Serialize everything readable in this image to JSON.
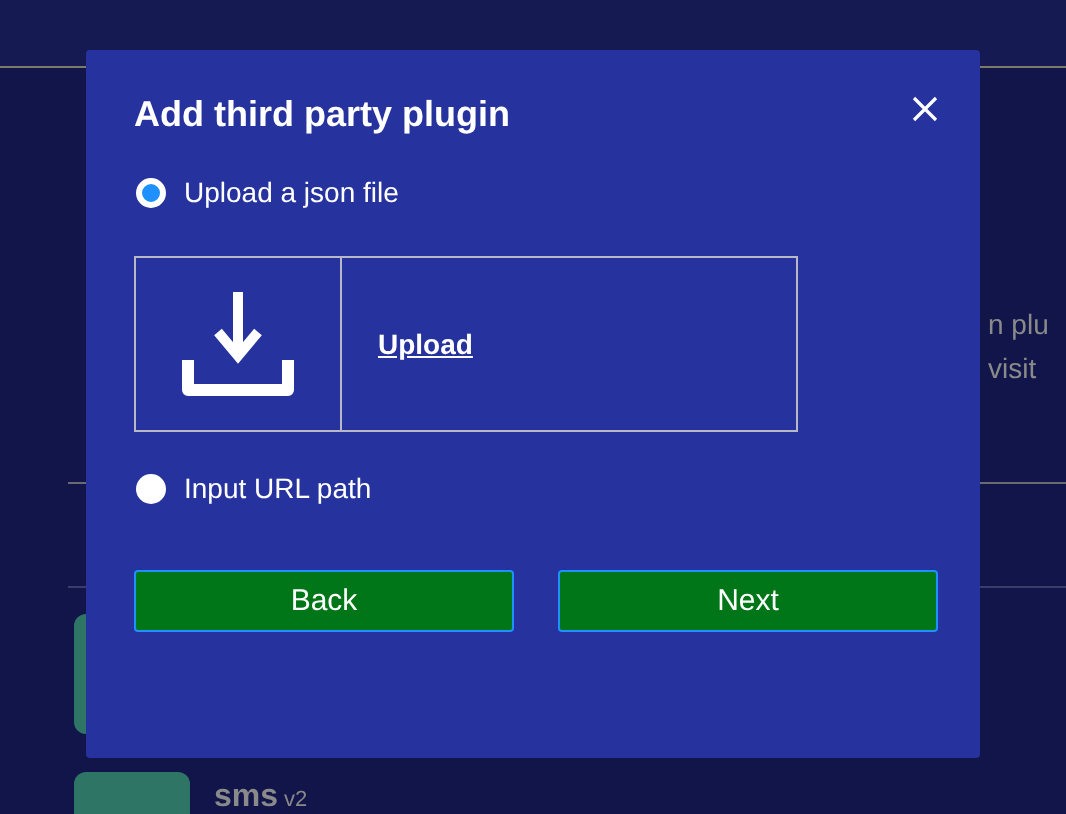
{
  "page": {
    "paragraph_right": [
      "n plu",
      "visit"
    ],
    "plugins": [
      {
        "kind": "photo"
      },
      {
        "kind": "photo",
        "name": "sms",
        "version": "v2"
      }
    ]
  },
  "dialog": {
    "title": "Add third party plugin",
    "options": [
      {
        "label": "Upload a json file",
        "selected": true,
        "kind": "upload"
      },
      {
        "label": "Input URL path",
        "selected": false,
        "kind": "url"
      }
    ],
    "upload": {
      "link": "Upload"
    },
    "buttons": [
      "Back",
      "Next"
    ]
  }
}
